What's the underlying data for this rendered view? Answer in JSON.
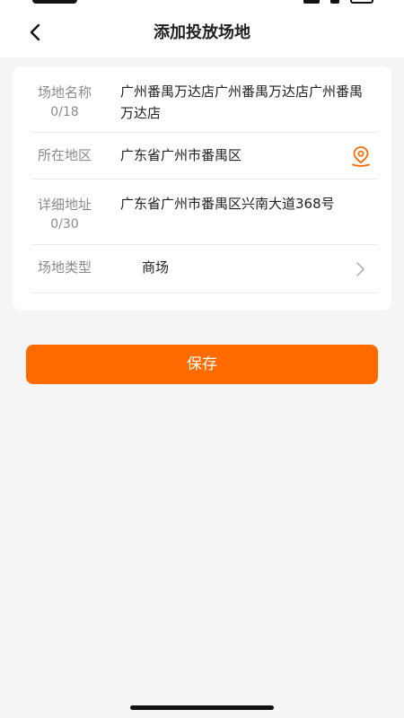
{
  "header": {
    "title": "添加投放场地",
    "back_icon": "chevron-left-icon"
  },
  "form": {
    "name": {
      "label": "场地名称",
      "counter": "0/18",
      "value": "广州番禺万达店广州番禺万达店广州番禺万达店"
    },
    "region": {
      "label": "所在地区",
      "value": "广东省广州市番禺区",
      "icon": "location-pin-icon"
    },
    "address": {
      "label": "详细地址",
      "counter": "0/30",
      "value": "广东省广州市番禺区兴南大道368号"
    },
    "type": {
      "label": "场地类型",
      "value": "商场",
      "icon": "chevron-right-icon"
    }
  },
  "actions": {
    "save_label": "保存"
  },
  "colors": {
    "accent": "#ff6a00",
    "background": "#f5f5f5",
    "card": "#ffffff",
    "label": "#8a8a8a",
    "text": "#222222"
  }
}
